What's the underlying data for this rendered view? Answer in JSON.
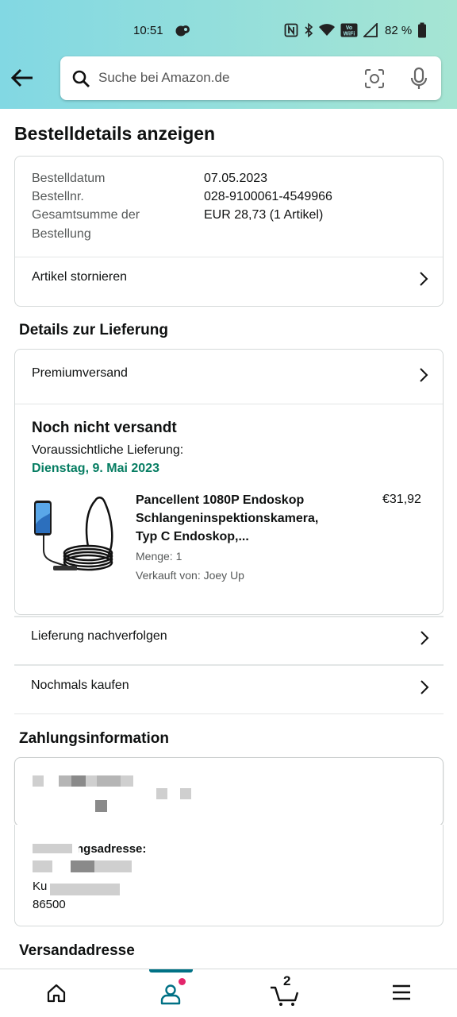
{
  "status_bar": {
    "time": "10:51",
    "battery": "82 %"
  },
  "search": {
    "placeholder": "Suche bei Amazon.de"
  },
  "page_title": "Bestelldetails anzeigen",
  "order_summary": {
    "date_label": "Bestelldatum",
    "date_value": "07.05.2023",
    "number_label": "Bestellnr.",
    "number_value": "028-9100061-4549966",
    "total_label_1": "Gesamtsumme der",
    "total_label_2": "Bestellung",
    "total_value": "EUR 28,73 (1 Artikel)",
    "cancel_label": "Artikel stornieren"
  },
  "delivery": {
    "section_title": "Details zur Lieferung",
    "shipping_method": "Premiumversand",
    "status": "Noch nicht versandt",
    "eta_label": "Voraussichtliche Lieferung:",
    "eta_date": "Dienstag, 9. Mai 2023",
    "product": {
      "title_line1": "Pancellent 1080P Endoskop",
      "title_line2": "Schlangeninspektionskamera,",
      "title_line3": "Typ C Endoskop,...",
      "price": "€31,92",
      "quantity": "Menge: 1",
      "seller": "Verkauft von: Joey Up"
    },
    "track_label": "Lieferung nachverfolgen",
    "buy_again_label": "Nochmals kaufen"
  },
  "payment": {
    "section_title": "Zahlungsinformation",
    "billing_label": "Rechnungsadresse:",
    "billing_line2": "Ku",
    "billing_zip": "86500"
  },
  "shipping_address": {
    "section_title": "Versandadresse"
  },
  "bottom_nav": {
    "cart_count": "2"
  },
  "colors": {
    "accent": "#007185",
    "delivery_green": "#067d62",
    "notif_dot": "#e3256b"
  }
}
